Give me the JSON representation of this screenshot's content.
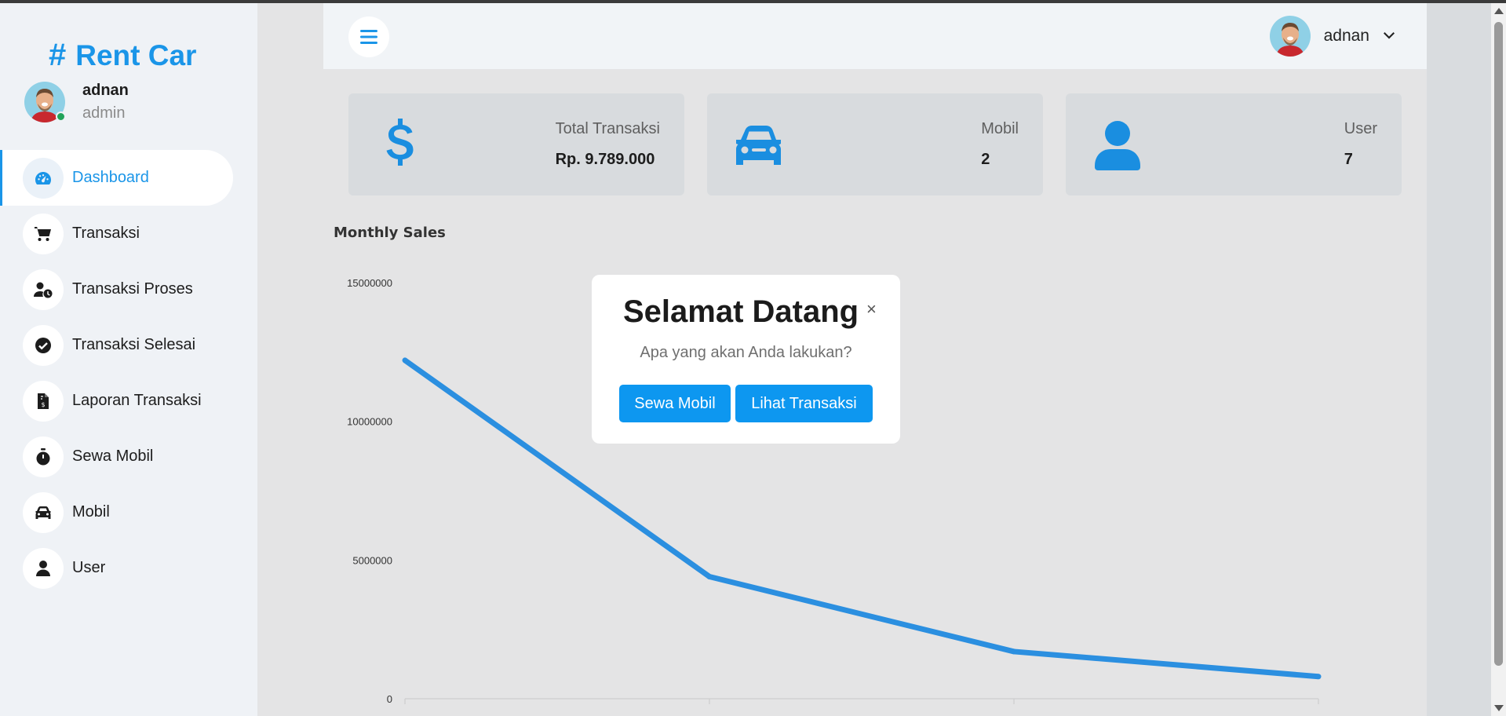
{
  "app": {
    "brand": "Rent Car",
    "brand_icon": "hash-icon",
    "accent_color": "#1a95e8"
  },
  "profile": {
    "name": "adnan",
    "role": "admin",
    "status": "online"
  },
  "sidebar": {
    "items": [
      {
        "label": "Dashboard",
        "icon": "dashboard-gauge-icon",
        "active": true
      },
      {
        "label": "Transaksi",
        "icon": "shopping-cart-icon"
      },
      {
        "label": "Transaksi Proses",
        "icon": "user-clock-icon"
      },
      {
        "label": "Transaksi Selesai",
        "icon": "check-circle-icon"
      },
      {
        "label": "Laporan Transaksi",
        "icon": "invoice-file-icon"
      },
      {
        "label": "Sewa Mobil",
        "icon": "stopwatch-icon"
      },
      {
        "label": "Mobil",
        "icon": "car-icon"
      },
      {
        "label": "User",
        "icon": "user-icon"
      }
    ]
  },
  "header": {
    "toggle_icon": "hamburger-icon",
    "user_name": "adnan",
    "dropdown_icon": "chevron-down-icon"
  },
  "cards": [
    {
      "title": "Total Transaksi",
      "value": "Rp. 9.789.000",
      "icon": "dollar-icon"
    },
    {
      "title": "Mobil",
      "value": "2",
      "icon": "car-icon"
    },
    {
      "title": "User",
      "value": "7",
      "icon": "user-icon"
    }
  ],
  "chart_data": {
    "type": "line",
    "title": "Monthly Sales",
    "x": [
      "",
      "",
      "",
      ""
    ],
    "series": [
      {
        "values": [
          12200000,
          4400000,
          1700000,
          800000
        ],
        "color": "#2b8fe0"
      }
    ],
    "yticks": [
      "15000000",
      "10000000",
      "5000000",
      "0"
    ],
    "ylim": [
      0,
      15000000
    ],
    "grid": false,
    "legend": "none"
  },
  "modal": {
    "title": "Selamat Datang",
    "close": "×",
    "subtitle": "Apa yang akan Anda lakukan?",
    "primary_button": "Sewa Mobil",
    "secondary_button": "Lihat Transaksi"
  }
}
